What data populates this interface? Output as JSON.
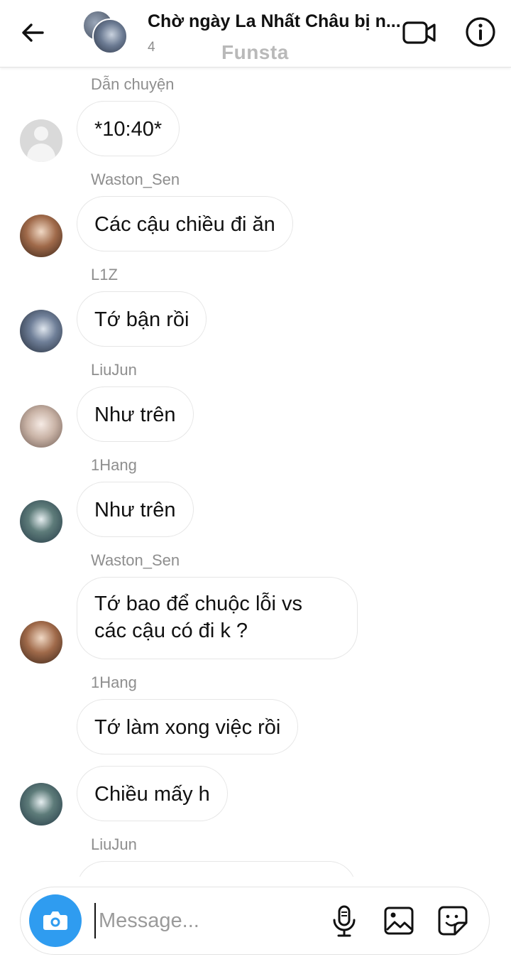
{
  "header": {
    "title": "Chờ ngày La Nhất Châu bị n...",
    "member_count": "4",
    "watermark": "Funsta"
  },
  "messages": [
    {
      "sender": "Dẫn chuyện",
      "text": "*10:40*",
      "avatar": "default-avatar"
    },
    {
      "sender": "Waston_Sen",
      "text": "Các cậu chiều đi ăn",
      "avatar": "avatar-waston-sen"
    },
    {
      "sender": "L1Z",
      "text": "Tớ bận rồi",
      "avatar": "avatar-l1z"
    },
    {
      "sender": "LiuJun",
      "text": "Như trên",
      "avatar": "avatar-liujun"
    },
    {
      "sender": "1Hang",
      "text": "Như trên",
      "avatar": "avatar-1hang"
    },
    {
      "sender": "Waston_Sen",
      "text": "Tớ bao để chuộc lỗi vs các cậu có đi k ?",
      "avatar": "avatar-waston-sen"
    },
    {
      "sender": "1Hang",
      "text": "Tớ làm xong việc rồi",
      "avatar": "none"
    },
    {
      "sender": "",
      "text": "Chiều mấy h",
      "avatar": "avatar-1hang"
    },
    {
      "sender": "LiuJun",
      "text": "",
      "avatar": "none"
    }
  ],
  "composer": {
    "placeholder": "Message..."
  },
  "icons": {
    "back": "arrow-left-icon",
    "video": "video-camera-icon",
    "info": "info-icon",
    "camera": "camera-icon",
    "mic": "microphone-icon",
    "gallery": "image-icon",
    "sticker": "sticker-icon"
  },
  "colors": {
    "accent": "#2f9cf0",
    "sender_text": "#8e8e8e",
    "bubble_border": "#e6e6e6"
  }
}
